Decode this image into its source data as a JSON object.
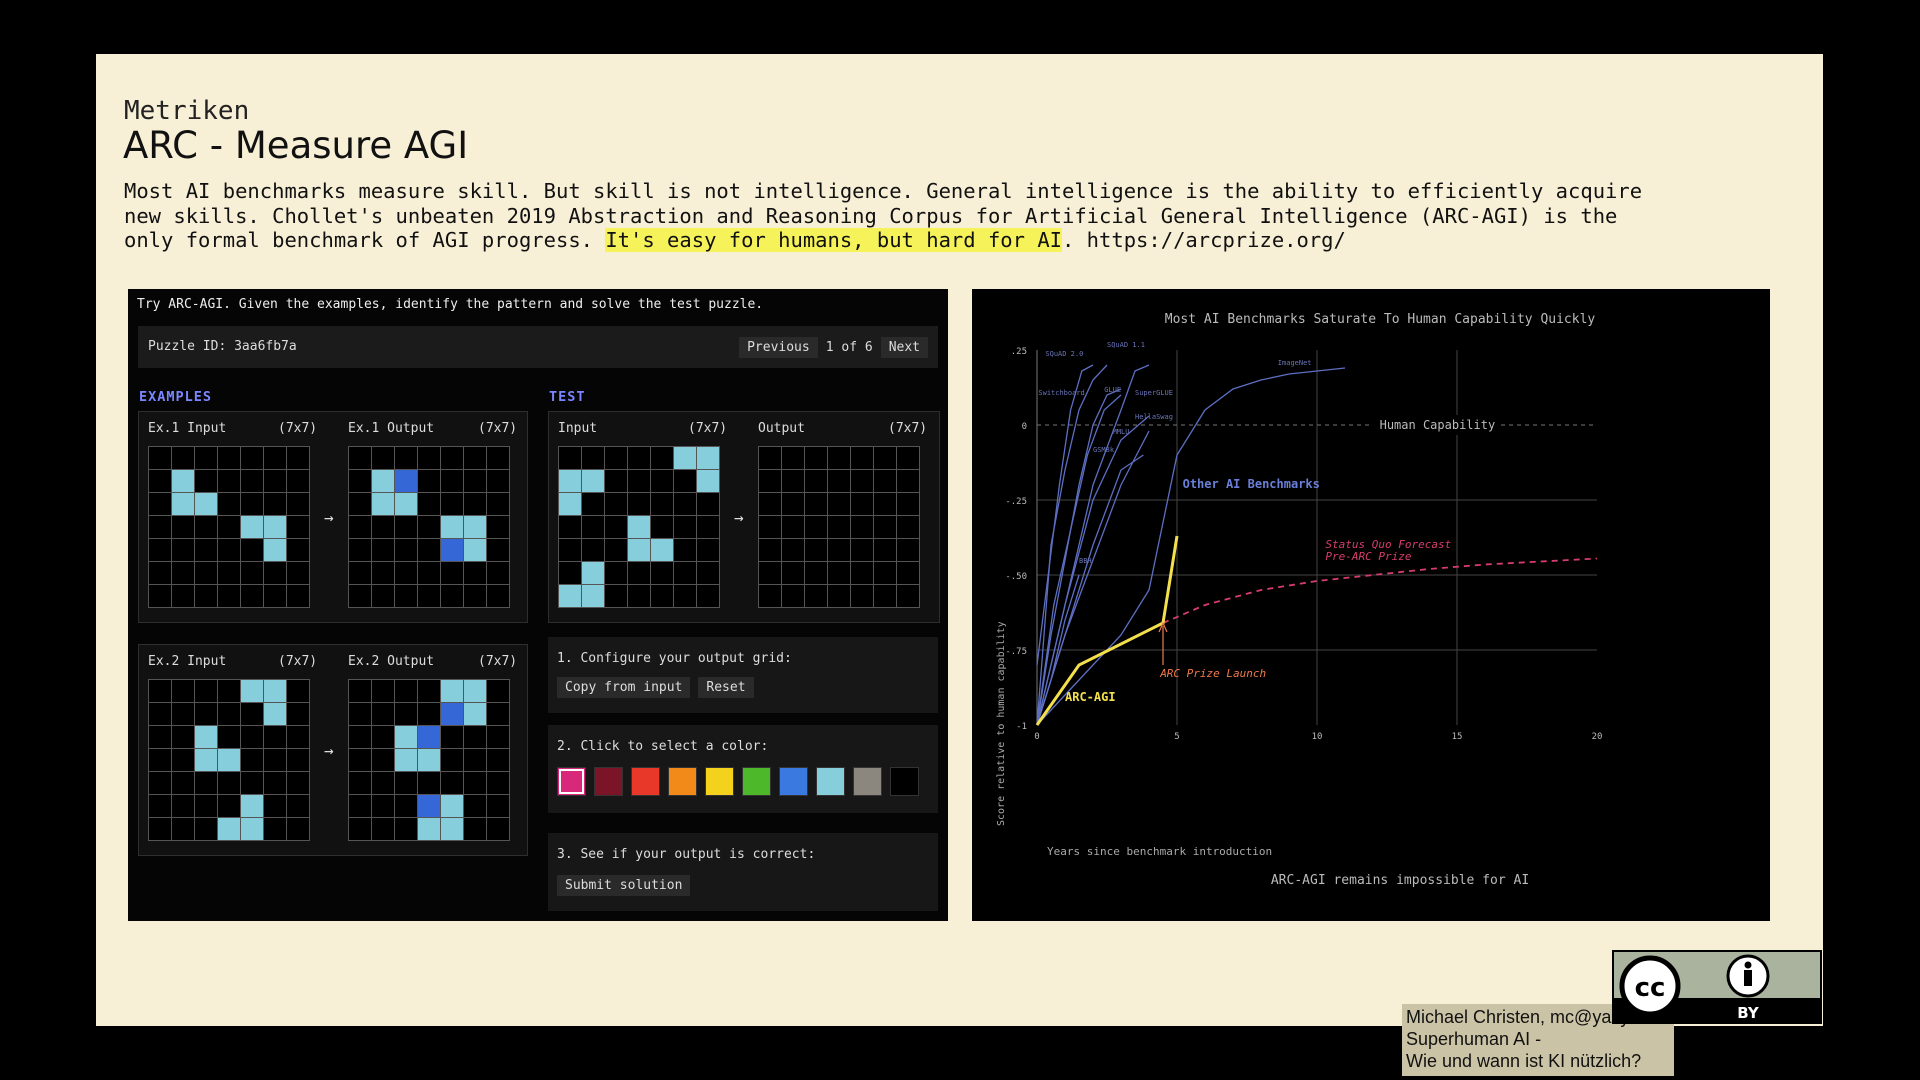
{
  "slide": {
    "kicker": "Metriken",
    "title": "ARC - Measure AGI",
    "desc_1": "Most AI benchmarks measure skill. But skill is not intelligence. General intelligence is the ability to efficiently acquire\nnew skills. Chollet's unbeaten 2019 Abstraction and Reasoning Corpus for Artificial General Intelligence (ARC-AGI) is the\nonly formal benchmark of AGI progress. ",
    "desc_hl": "It's easy for humans, but hard for AI",
    "desc_2": ". https://arcprize.org/"
  },
  "arc": {
    "intro": "Try ARC-AGI. Given the examples, identify the pattern and solve the test puzzle.",
    "puzzle_id": "Puzzle ID: 3aa6fb7a",
    "prev": "Previous",
    "page": "1 of 6",
    "next": "Next",
    "examples_title": "EXAMPLES",
    "test_title": "TEST",
    "ex1_in": "Ex.1 Input",
    "ex1_out": "Ex.1 Output",
    "ex2_in": "Ex.2 Input",
    "ex2_out": "Ex.2 Output",
    "test_in": "Input",
    "test_out": "Output",
    "size": "(7x7)",
    "arrow": "→",
    "step1": "1. Configure your output grid:",
    "copy": "Copy from input",
    "reset": "Reset",
    "step2": "2. Click to select a color:",
    "step3": "3. See if your output is correct:",
    "submit": "Submit solution",
    "palette": [
      "#d8287a",
      "#7a1426",
      "#e8382a",
      "#f28a1a",
      "#f4d21c",
      "#4cb82a",
      "#3a7ae0",
      "#86cedc",
      "#8c877e",
      "#000000"
    ],
    "grids": {
      "ex1_in": [
        [
          0,
          0,
          0,
          0,
          0,
          0,
          0
        ],
        [
          0,
          8,
          0,
          0,
          0,
          0,
          0
        ],
        [
          0,
          8,
          8,
          0,
          0,
          0,
          0
        ],
        [
          0,
          0,
          0,
          0,
          8,
          8,
          0
        ],
        [
          0,
          0,
          0,
          0,
          0,
          8,
          0
        ],
        [
          0,
          0,
          0,
          0,
          0,
          0,
          0
        ],
        [
          0,
          0,
          0,
          0,
          0,
          0,
          0
        ]
      ],
      "ex1_out": [
        [
          0,
          0,
          0,
          0,
          0,
          0,
          0
        ],
        [
          0,
          8,
          1,
          0,
          0,
          0,
          0
        ],
        [
          0,
          8,
          8,
          0,
          0,
          0,
          0
        ],
        [
          0,
          0,
          0,
          0,
          8,
          8,
          0
        ],
        [
          0,
          0,
          0,
          0,
          1,
          8,
          0
        ],
        [
          0,
          0,
          0,
          0,
          0,
          0,
          0
        ],
        [
          0,
          0,
          0,
          0,
          0,
          0,
          0
        ]
      ],
      "ex2_in": [
        [
          0,
          0,
          0,
          0,
          8,
          8,
          0
        ],
        [
          0,
          0,
          0,
          0,
          0,
          8,
          0
        ],
        [
          0,
          0,
          8,
          0,
          0,
          0,
          0
        ],
        [
          0,
          0,
          8,
          8,
          0,
          0,
          0
        ],
        [
          0,
          0,
          0,
          0,
          0,
          0,
          0
        ],
        [
          0,
          0,
          0,
          0,
          8,
          0,
          0
        ],
        [
          0,
          0,
          0,
          8,
          8,
          0,
          0
        ]
      ],
      "ex2_out": [
        [
          0,
          0,
          0,
          0,
          8,
          8,
          0
        ],
        [
          0,
          0,
          0,
          0,
          1,
          8,
          0
        ],
        [
          0,
          0,
          8,
          1,
          0,
          0,
          0
        ],
        [
          0,
          0,
          8,
          8,
          0,
          0,
          0
        ],
        [
          0,
          0,
          0,
          0,
          0,
          0,
          0
        ],
        [
          0,
          0,
          0,
          1,
          8,
          0,
          0
        ],
        [
          0,
          0,
          0,
          8,
          8,
          0,
          0
        ]
      ],
      "test_in": [
        [
          0,
          0,
          0,
          0,
          0,
          8,
          8
        ],
        [
          8,
          8,
          0,
          0,
          0,
          0,
          8
        ],
        [
          8,
          0,
          0,
          0,
          0,
          0,
          0
        ],
        [
          0,
          0,
          0,
          8,
          0,
          0,
          0
        ],
        [
          0,
          0,
          0,
          8,
          8,
          0,
          0
        ],
        [
          0,
          8,
          0,
          0,
          0,
          0,
          0
        ],
        [
          8,
          8,
          0,
          0,
          0,
          0,
          0
        ]
      ],
      "test_out": [
        [
          0,
          0,
          0,
          0,
          0,
          0,
          0
        ],
        [
          0,
          0,
          0,
          0,
          0,
          0,
          0
        ],
        [
          0,
          0,
          0,
          0,
          0,
          0,
          0
        ],
        [
          0,
          0,
          0,
          0,
          0,
          0,
          0
        ],
        [
          0,
          0,
          0,
          0,
          0,
          0,
          0
        ],
        [
          0,
          0,
          0,
          0,
          0,
          0,
          0
        ],
        [
          0,
          0,
          0,
          0,
          0,
          0,
          0
        ]
      ]
    }
  },
  "chart_data": {
    "type": "line",
    "title": "Most AI Benchmarks Saturate To Human Capability Quickly",
    "subtitle": "ARC-AGI remains impossible for AI",
    "xlabel": "Years since benchmark introduction",
    "ylabel": "Score relative to human capability",
    "xlim": [
      0,
      20
    ],
    "ylim": [
      -1,
      0.25
    ],
    "xticks": [
      "0",
      "5",
      "10",
      "15",
      "20"
    ],
    "xtick_values": [
      0,
      5,
      10,
      15,
      20
    ],
    "yticks": [
      ".25",
      "0",
      "-.25",
      "-.50",
      "-.75",
      "-1"
    ],
    "ytick_values": [
      0.25,
      0,
      -0.25,
      -0.5,
      -0.75,
      -1
    ],
    "human_line_label": "Human Capability",
    "other_label": "Other AI Benchmarks",
    "arc_label": "ARC-AGI",
    "launch_label": "ARC Prize Launch",
    "forecast_label_1": "Status Quo Forecast",
    "forecast_label_2": "Pre-ARC Prize",
    "colors": {
      "benchmarks": "#5d6fc2",
      "arc": "#f4e04d",
      "forecast": "#d63d6c",
      "launch": "#f07a4a",
      "grid": "#444",
      "text": "#bbb"
    },
    "benchmark_names": [
      "SQuAD 2.0",
      "SQuAD 1.1",
      "Switchboard",
      "GLUE",
      "SuperGLUE",
      "HellaSwag",
      "MMLU",
      "GSM8k",
      "ImageNet",
      "BBH"
    ],
    "series": [
      {
        "name": "Switchboard",
        "x": [
          0,
          0.4,
          0.8,
          1.2,
          1.6,
          2.0
        ],
        "y": [
          -0.8,
          -0.5,
          -0.2,
          0.05,
          0.18,
          0.2
        ]
      },
      {
        "name": "SQuAD 2.0",
        "x": [
          0,
          0.5,
          1.0,
          1.5,
          2.0,
          2.5
        ],
        "y": [
          -1,
          -0.4,
          -0.15,
          0.05,
          0.15,
          0.2
        ]
      },
      {
        "name": "SQuAD 1.1",
        "x": [
          0,
          1,
          2,
          3,
          3.5,
          4
        ],
        "y": [
          -1,
          -0.6,
          -0.2,
          0.05,
          0.18,
          0.2
        ]
      },
      {
        "name": "GLUE",
        "x": [
          0,
          0.5,
          1.0,
          1.5,
          2.0,
          2.5,
          3.0
        ],
        "y": [
          -1,
          -0.7,
          -0.45,
          -0.2,
          0,
          0.1,
          0.12
        ]
      },
      {
        "name": "SuperGLUE",
        "x": [
          0,
          0.6,
          1.2,
          1.8,
          2.4,
          3.0
        ],
        "y": [
          -1,
          -0.6,
          -0.35,
          -0.1,
          0.05,
          0.1
        ]
      },
      {
        "name": "HellaSwag",
        "x": [
          0,
          1,
          2,
          3,
          4
        ],
        "y": [
          -1,
          -0.6,
          -0.25,
          -0.05,
          0.03
        ]
      },
      {
        "name": "MMLU",
        "x": [
          0,
          1,
          2,
          3,
          4
        ],
        "y": [
          -1,
          -0.7,
          -0.45,
          -0.2,
          -0.02
        ]
      },
      {
        "name": "GSM8k",
        "x": [
          0,
          1,
          2,
          3,
          3.8
        ],
        "y": [
          -1,
          -0.7,
          -0.4,
          -0.15,
          -0.1
        ]
      },
      {
        "name": "BBH",
        "x": [
          0,
          0.5,
          1.0,
          1.5
        ],
        "y": [
          -1,
          -0.85,
          -0.65,
          -0.5
        ]
      },
      {
        "name": "ImageNet",
        "x": [
          0,
          1,
          2,
          3,
          4,
          5,
          6,
          7,
          8,
          9,
          10,
          11
        ],
        "y": [
          -1,
          -0.9,
          -0.8,
          -0.7,
          -0.55,
          -0.1,
          0.05,
          0.12,
          0.15,
          0.17,
          0.18,
          0.19
        ]
      }
    ],
    "arc_series": {
      "x": [
        0,
        1.5,
        4.5,
        5
      ],
      "y": [
        -1,
        -0.8,
        -0.66,
        -0.37
      ]
    },
    "forecast_series": {
      "x": [
        4.5,
        6,
        8,
        10,
        12,
        14,
        16,
        18,
        20
      ],
      "y": [
        -0.66,
        -0.6,
        -0.55,
        -0.52,
        -0.5,
        -0.48,
        -0.465,
        -0.455,
        -0.445
      ]
    },
    "launch_x": 4.5
  },
  "footer": {
    "line1": "Michael Christen, mc@yacy.net",
    "line2": "Superhuman AI -",
    "line3": "Wie und wann ist KI nützlich?",
    "cc": "cc",
    "by": "BY"
  }
}
